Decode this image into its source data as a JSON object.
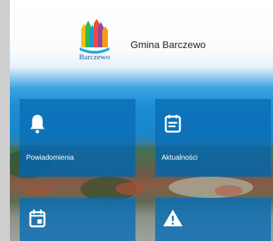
{
  "app": {
    "title": "Gmina Barczewo",
    "logo_text": "Barczewo",
    "logo_sub": ""
  },
  "tiles": [
    {
      "label": "Powiadomienia",
      "icon": "bell-icon"
    },
    {
      "label": "Aktualności",
      "icon": "news-icon"
    },
    {
      "label": "",
      "icon": "calendar-icon"
    },
    {
      "label": "",
      "icon": "warning-icon"
    }
  ],
  "colors": {
    "tile": "#0a6eb4",
    "sky": "#1d8dd4",
    "title_text": "#222222",
    "logo_text": "#1c5a8f"
  }
}
